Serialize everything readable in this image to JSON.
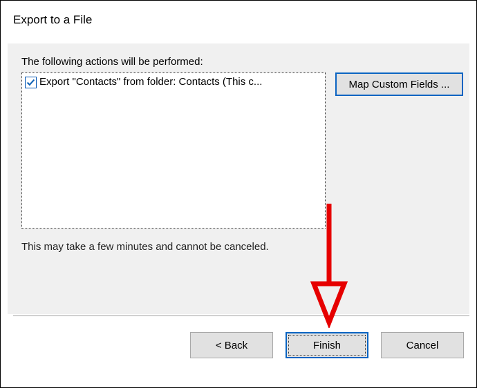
{
  "window": {
    "title": "Export to a File"
  },
  "content": {
    "prompt": "The following actions will be performed:",
    "actions": [
      {
        "checked": true,
        "label": "Export \"Contacts\" from folder: Contacts (This c..."
      }
    ],
    "map_button": "Map Custom Fields ...",
    "warning": "This may take a few minutes and cannot be canceled."
  },
  "buttons": {
    "back": "< Back",
    "finish": "Finish",
    "cancel": "Cancel"
  },
  "annotation": {
    "color": "#e60000"
  }
}
